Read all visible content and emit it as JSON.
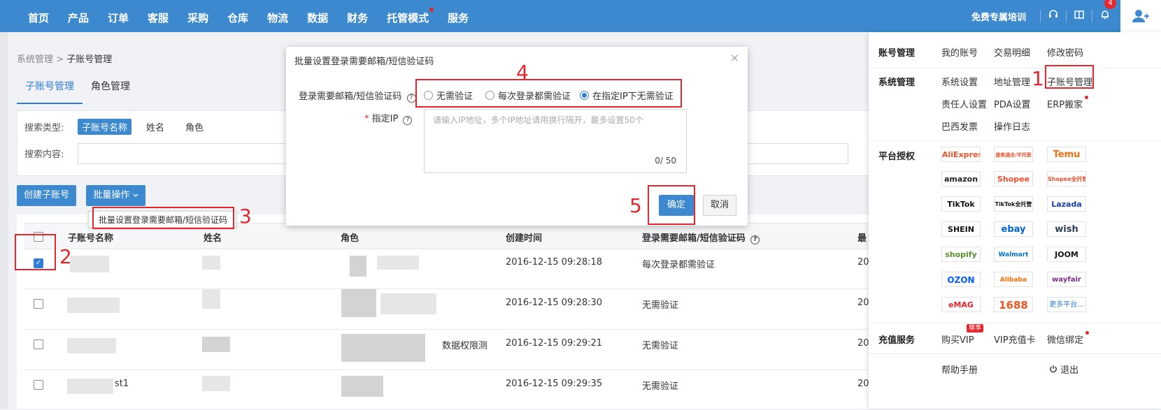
{
  "nav": {
    "items": [
      "首页",
      "产品",
      "订单",
      "客服",
      "采购",
      "仓库",
      "物流",
      "数据",
      "财务",
      "托管模式",
      "服务"
    ],
    "training": "免费专属培训",
    "bell_count": "4"
  },
  "breadcrumb": {
    "parent": "系统管理",
    "sep": ">",
    "current": "子账号管理"
  },
  "tabs": [
    "子账号管理",
    "角色管理"
  ],
  "search": {
    "type_label": "搜索类型:",
    "type_options": [
      "子账号名称",
      "姓名",
      "角色"
    ],
    "content_label": "搜索内容:"
  },
  "actions": {
    "create": "创建子账号",
    "batch": "批量操作",
    "batch_menu_item": "批量设置登录需要邮箱/短信验证码"
  },
  "table": {
    "headers": [
      "子账号名称",
      "姓名",
      "角色",
      "创建时间",
      "登录需要邮箱/短信验证码",
      "最"
    ],
    "rows": [
      {
        "checked": true,
        "role_text": "",
        "created": "2016-12-15 09:28:18",
        "verify": "每次登录都需验证",
        "last": "20"
      },
      {
        "checked": false,
        "role_text": "",
        "created": "2016-12-15 09:28:30",
        "verify": "无需验证",
        "last": "20"
      },
      {
        "checked": false,
        "role_text": "数据权限测",
        "created": "2016-12-15 09:29:21",
        "verify": "无需验证",
        "last": "20"
      },
      {
        "checked": false,
        "name_suffix": "st1",
        "role_text": "",
        "created": "2016-12-15 09:29:35",
        "verify": "无需验证",
        "last": "20"
      }
    ]
  },
  "modal": {
    "title": "批量设置登录需要邮箱/短信验证码",
    "close": "×",
    "verify_label": "登录需要邮箱/短信验证码",
    "options": [
      "无需验证",
      "每次登录都需验证",
      "在指定IP下无需验证"
    ],
    "selected_option": 2,
    "ip_label": "指定IP",
    "required_mark": "*",
    "ip_placeholder": "请输入IP地址，多个IP地址请用换行隔开，最多设置50个",
    "ip_count": "0/ 50",
    "ok": "确定",
    "cancel": "取消"
  },
  "panel": {
    "account": {
      "head": "账号管理",
      "items": [
        "我的账号",
        "交易明细",
        "修改密码"
      ]
    },
    "system": {
      "head": "系统管理",
      "items": [
        "系统设置",
        "地址管理",
        "子账号管理",
        "责任人设置",
        "PDA设置",
        "ERP搬家",
        "巴西发票",
        "操作日志"
      ]
    },
    "platform": {
      "head": "平台授权",
      "logos": [
        "AliExpress",
        "速卖通全/半托管",
        "Temu",
        "amazon",
        "Shopee",
        "Shopee全托管",
        "TikTok",
        "TikTok全托管",
        "Lazada",
        "SHEIN",
        "ebay",
        "wish",
        "shopify",
        "Walmart",
        "JOOM",
        "OZON",
        "Alibaba",
        "wayfair",
        "eMAG",
        "1688",
        "更多平台..."
      ]
    },
    "recharge": {
      "head": "充值服务",
      "items": [
        "购买VIP",
        "VIP充值卡",
        "微信绑定"
      ],
      "vip_badge": "尊享"
    },
    "help": "帮助手册",
    "logout": "退出"
  },
  "annotations": [
    "1",
    "2",
    "3",
    "4",
    "5"
  ],
  "colors": {
    "primary": "#3c89cf",
    "highlight": "#e5262d",
    "link": "#2e7ed8"
  }
}
